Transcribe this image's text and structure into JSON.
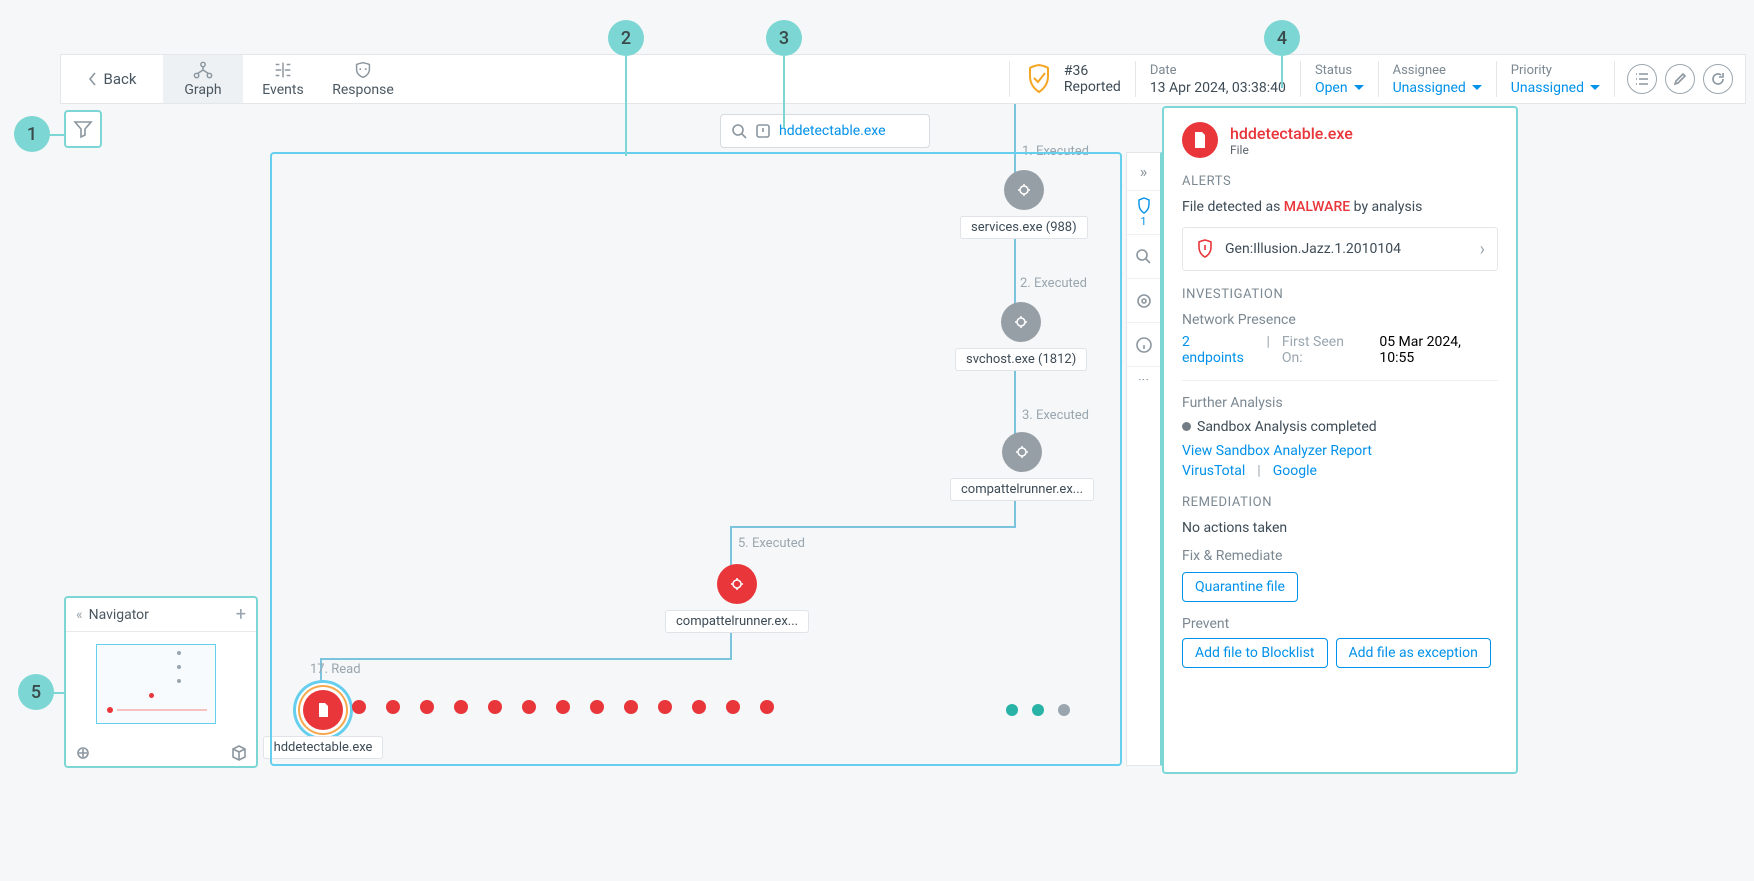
{
  "callouts": {
    "c1": "1",
    "c2": "2",
    "c3": "3",
    "c4": "4",
    "c5": "5"
  },
  "toolbar": {
    "back_label": "Back"
  },
  "tabs": {
    "graph": "Graph",
    "events": "Events",
    "response": "Response"
  },
  "header": {
    "alert_id": "#36",
    "alert_status": "Reported",
    "date_label": "Date",
    "date_value": "13 Apr 2024, 03:38:40",
    "status_label": "Status",
    "status_value": "Open",
    "assignee_label": "Assignee",
    "assignee_value": "Unassigned",
    "priority_label": "Priority",
    "priority_value": "Unassigned"
  },
  "search": {
    "value": "hddetectable.exe"
  },
  "graph": {
    "nodes": [
      {
        "edge_label": "1. Executed",
        "label": "services.exe (988)"
      },
      {
        "edge_label": "2. Executed",
        "label": "svchost.exe (1812)"
      },
      {
        "edge_label": "3. Executed",
        "label": "compattelrunner.ex..."
      },
      {
        "edge_label": "5. Executed",
        "label": "compattelrunner.ex..."
      },
      {
        "edge_label": "17. Read",
        "label": "hddetectable.exe"
      }
    ]
  },
  "navigator": {
    "title": "Navigator"
  },
  "rail": {
    "shield_count": "1"
  },
  "panel": {
    "file_name": "hddetectable.exe",
    "file_kind": "File",
    "alerts_heading": "ALERTS",
    "alert_text_pre": "File detected as ",
    "alert_text_malware": "MALWARE",
    "alert_text_post": " by analysis",
    "alert_item": "Gen:Illusion.Jazz.1.2010104",
    "inv_heading": "INVESTIGATION",
    "net_presence": "Network Presence",
    "endpoints": "2 endpoints",
    "first_seen_label": "First Seen On:",
    "first_seen_value": "05 Mar 2024, 10:55",
    "further_analysis": "Further Analysis",
    "sandbox_done": "Sandbox Analysis completed",
    "sandbox_report": "View Sandbox Analyzer Report",
    "vt": "VirusTotal",
    "google": "Google",
    "rem_heading": "REMEDIATION",
    "no_actions": "No actions taken",
    "fix_rem": "Fix & Remediate",
    "quarantine": "Quarantine file",
    "prevent": "Prevent",
    "blocklist": "Add file to Blocklist",
    "exception": "Add file as exception"
  }
}
